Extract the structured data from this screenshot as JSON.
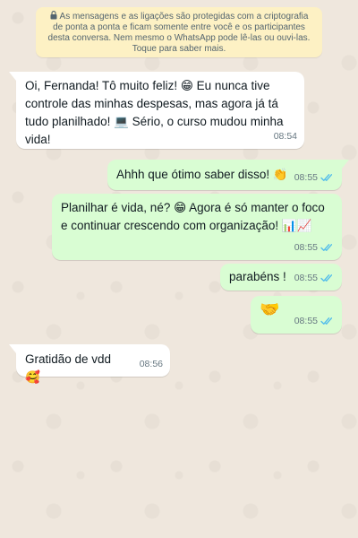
{
  "encryption_notice": {
    "text": "As mensagens e as ligações são protegidas com a criptografia de ponta a ponta e ficam somente entre você e os participantes desta conversa. Nem mesmo o WhatsApp pode lê-las ou ouvi-las. Toque para saber mais."
  },
  "messages": [
    {
      "direction": "incoming",
      "text": "Oi, Fernanda! Tô muito feliz! 😁 Eu nunca tive controle das minhas despesas, mas agora já tá tudo planilhado! 💻 Sério, o curso mudou minha vida!",
      "time": "08:54"
    },
    {
      "direction": "outgoing",
      "text": "Ahhh que ótimo saber disso! 👏",
      "time": "08:55",
      "status": "read"
    },
    {
      "direction": "outgoing",
      "text": "Planilhar é vida, né? 😁 Agora é só manter o foco e continuar crescendo com organização! 📊📈",
      "time": "08:55",
      "status": "read"
    },
    {
      "direction": "outgoing",
      "text": "parabéns !",
      "time": "08:55",
      "status": "read"
    },
    {
      "direction": "outgoing",
      "text": "🤝",
      "time": "08:55",
      "status": "read"
    },
    {
      "direction": "incoming",
      "text": "Gratidão de vdd 🥰",
      "time": "08:56"
    }
  ],
  "colors": {
    "wallpaper": "#efe7dd",
    "incoming_bubble": "#ffffff",
    "outgoing_bubble": "#d9fdd3",
    "notice_background": "#fdf1c4",
    "read_ticks": "#53bdeb",
    "timestamp": "#667781"
  }
}
